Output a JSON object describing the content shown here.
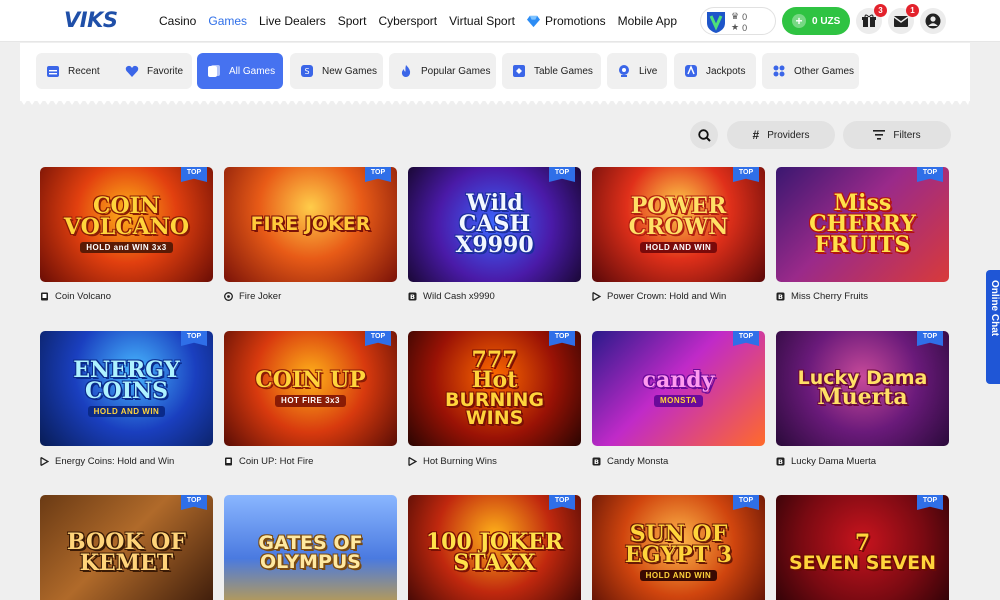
{
  "header": {
    "logo": "VIKS",
    "nav": [
      {
        "label": "Casino",
        "active": false
      },
      {
        "label": "Games",
        "active": true
      },
      {
        "label": "Live Dealers",
        "active": false
      },
      {
        "label": "Sport",
        "active": false
      },
      {
        "label": "Cybersport",
        "active": false
      },
      {
        "label": "Virtual Sport",
        "active": false
      },
      {
        "label": "Promotions",
        "active": false,
        "icon": "diamond-icon"
      },
      {
        "label": "Mobile App",
        "active": false
      }
    ],
    "loyalty": {
      "points_top": "0",
      "points_bottom": "0"
    },
    "balance": "0 UZS",
    "gift_badge": "3",
    "mail_badge": "1"
  },
  "categories": [
    {
      "label": "Recent",
      "icon": "calendar-icon",
      "active": false
    },
    {
      "label": "Favorite",
      "icon": "heart-icon",
      "active": false
    },
    {
      "label": "All Games",
      "icon": "cards-icon",
      "active": true
    },
    {
      "label": "New Games",
      "icon": "new-icon",
      "active": false
    },
    {
      "label": "Popular Games",
      "icon": "flame-icon",
      "active": false
    },
    {
      "label": "Table Games",
      "icon": "dice-icon",
      "active": false
    },
    {
      "label": "Live",
      "icon": "live-icon",
      "active": false
    },
    {
      "label": "Jackpots",
      "icon": "jackpot-icon",
      "active": false
    },
    {
      "label": "Other Games",
      "icon": "grid-icon",
      "active": false
    }
  ],
  "toolbar": {
    "providers": "Providers",
    "filters": "Filters"
  },
  "games": [
    {
      "name": "Coin Volcano",
      "title": [
        "COIN",
        "VOLCANO"
      ],
      "sub": "HOLD and WIN 3x3",
      "badge": "TOP",
      "provider_icon": "square-icon"
    },
    {
      "name": "Fire Joker",
      "title": [
        "FIRE JOKER"
      ],
      "sub": "",
      "badge": "TOP",
      "provider_icon": "at-icon"
    },
    {
      "name": "Wild Cash x9990",
      "title": [
        "Wild",
        "CASH",
        "X9990"
      ],
      "sub": "",
      "badge": "TOP",
      "provider_icon": "b-icon"
    },
    {
      "name": "Power Crown: Hold and Win",
      "title": [
        "POWER",
        "CROWN"
      ],
      "sub": "HOLD AND WIN",
      "badge": "TOP",
      "provider_icon": "play-icon"
    },
    {
      "name": "Miss Cherry Fruits",
      "title": [
        "Miss",
        "CHERRY",
        "FRUITS"
      ],
      "sub": "",
      "badge": "TOP",
      "provider_icon": "b-icon"
    },
    {
      "name": "Energy Coins: Hold and Win",
      "title": [
        "ENERGY",
        "COINS"
      ],
      "sub": "HOLD AND WIN",
      "badge": "TOP",
      "provider_icon": "play-icon"
    },
    {
      "name": "Coin UP: Hot Fire",
      "title": [
        "COIN UP"
      ],
      "sub": "HOT FIRE 3x3",
      "badge": "TOP",
      "provider_icon": "square-icon"
    },
    {
      "name": "Hot Burning Wins",
      "title": [
        "777",
        "Hot",
        "BURNING WINS"
      ],
      "sub": "",
      "badge": "TOP",
      "provider_icon": "play-icon"
    },
    {
      "name": "Candy Monsta",
      "title": [
        "candy"
      ],
      "sub": "MONSTA",
      "badge": "TOP",
      "provider_icon": "b-icon"
    },
    {
      "name": "Lucky Dama Muerta",
      "title": [
        "Lucky Dama",
        "Muerta"
      ],
      "sub": "",
      "badge": "TOP",
      "provider_icon": "b-icon"
    },
    {
      "name": "Book of Kemet",
      "title": [
        "BOOK OF",
        "KEMET"
      ],
      "sub": "",
      "badge": "TOP",
      "provider_icon": ""
    },
    {
      "name": "Gates of Olympus",
      "title": [
        "GATES OF OLYMPUS"
      ],
      "sub": "",
      "badge": "",
      "provider_icon": ""
    },
    {
      "name": "100 Joker Staxx",
      "title": [
        "100 JOKER",
        "STAXX"
      ],
      "sub": "",
      "badge": "TOP",
      "provider_icon": ""
    },
    {
      "name": "Sun of Egypt 3",
      "title": [
        "SUN OF",
        "EGYPT 3"
      ],
      "sub": "HOLD AND WIN",
      "badge": "TOP",
      "provider_icon": ""
    },
    {
      "name": "Seven Seven",
      "title": [
        "7",
        "SEVEN SEVEN"
      ],
      "sub": "",
      "badge": "TOP",
      "provider_icon": ""
    }
  ],
  "chat": "Online Chat"
}
